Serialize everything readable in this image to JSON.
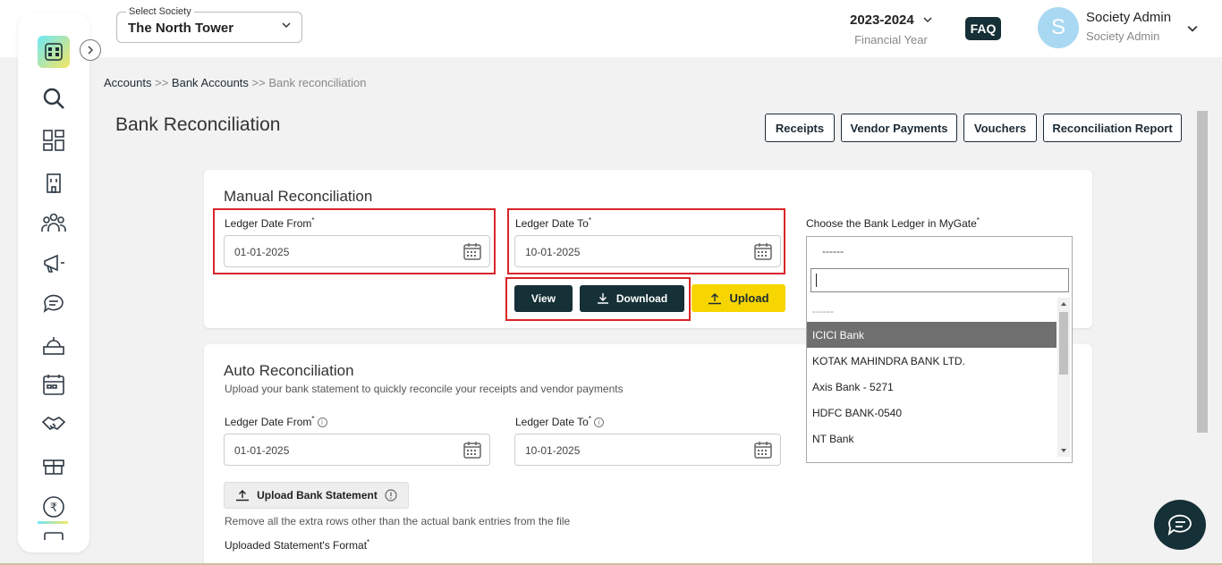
{
  "header": {
    "society_label": "Select Society",
    "society_value": "The North Tower",
    "financial_year": "2023-2024",
    "financial_year_label": "Financial Year",
    "faq_label": "FAQ",
    "avatar_initial": "S",
    "user_name": "Society Admin",
    "user_role": "Society Admin"
  },
  "sidebar": {
    "logo_text": "∷ıʇ",
    "items": [
      "search-icon",
      "dashboard-icon",
      "building-icon",
      "members-icon",
      "announcement-icon",
      "chat-icon",
      "amenity-icon",
      "calendar-icon",
      "handshake-icon",
      "gift-icon",
      "rupee-icon",
      "check-icon"
    ]
  },
  "breadcrumb": {
    "items": [
      "Accounts",
      "Bank Accounts",
      "Bank reconciliation"
    ],
    "separator": ">>"
  },
  "page": {
    "title": "Bank Reconciliation",
    "buttons": [
      "Receipts",
      "Vendor Payments",
      "Vouchers",
      "Reconciliation Report"
    ]
  },
  "manual": {
    "title": "Manual Reconciliation",
    "from_label": "Ledger Date From",
    "from_value": "01-01-2025",
    "to_label": "Ledger Date To",
    "to_value": "10-01-2025",
    "ledger_label": "Choose the Bank Ledger in MyGate",
    "view_label": "View",
    "download_label": "Download",
    "upload_label": "Upload"
  },
  "dropdown": {
    "selected": "------",
    "options": [
      "------",
      "ICICI Bank",
      "KOTAK MAHINDRA BANK LTD.",
      "Axis Bank - 5271",
      "HDFC BANK-0540",
      "NT Bank"
    ],
    "highlighted": "ICICI Bank"
  },
  "auto": {
    "title": "Auto Reconciliation",
    "subtitle": "Upload your bank statement to quickly reconcile your receipts and vendor payments",
    "from_label": "Ledger Date From",
    "from_value": "01-01-2025",
    "to_label": "Ledger Date To",
    "to_value": "10-01-2025",
    "upload_statement_label": "Upload Bank Statement",
    "remove_hint": "Remove all the extra rows other than the actual bank entries from the file",
    "format_label": "Uploaded Statement's Format"
  },
  "colors": {
    "dark": "#153036",
    "yellow": "#f7d500",
    "highlight_red": "#d9252a",
    "page_bg": "#f2f2f2"
  }
}
